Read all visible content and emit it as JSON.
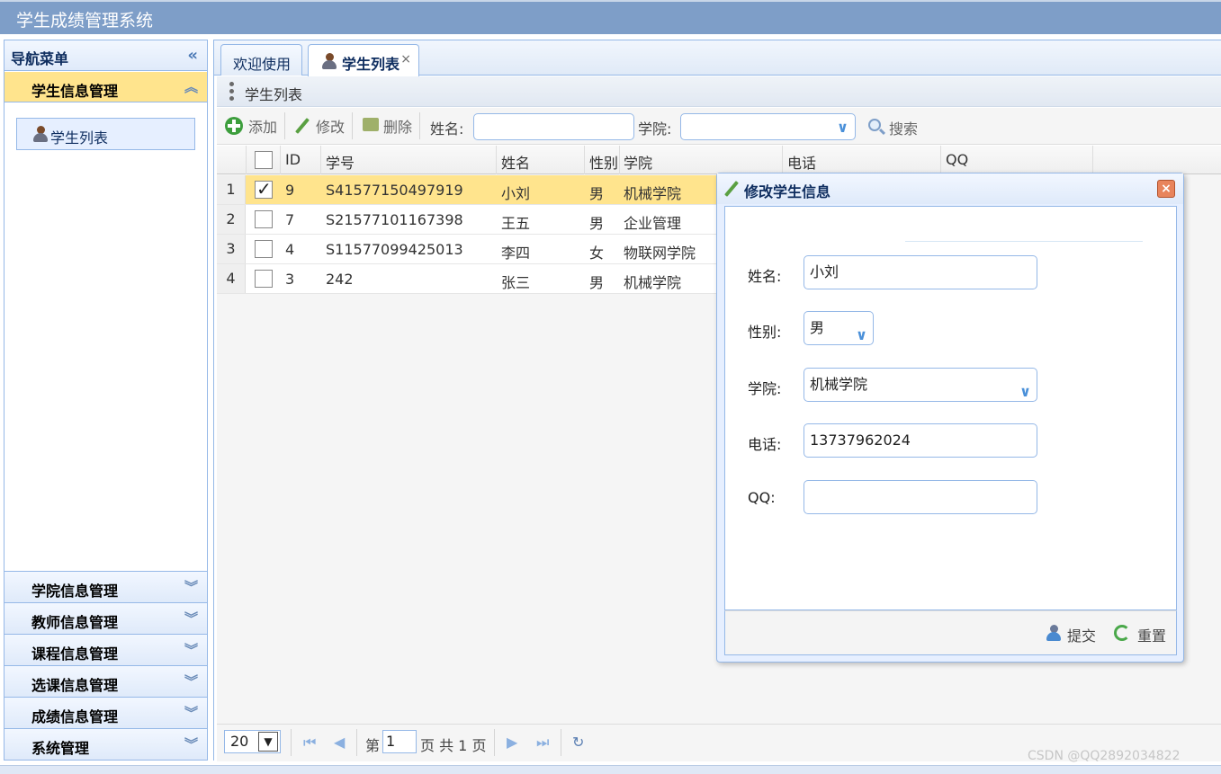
{
  "app": {
    "title": "学生成绩管理系统"
  },
  "sidebar": {
    "title": "导航菜单",
    "open_section": {
      "label": "学生信息管理",
      "items": [
        {
          "label": "学生列表"
        }
      ]
    },
    "sections": [
      {
        "label": "学院信息管理"
      },
      {
        "label": "教师信息管理"
      },
      {
        "label": "课程信息管理"
      },
      {
        "label": "选课信息管理"
      },
      {
        "label": "成绩信息管理"
      },
      {
        "label": "系统管理"
      }
    ]
  },
  "tabs": [
    {
      "label": "欢迎使用"
    },
    {
      "label": "学生列表"
    }
  ],
  "grid": {
    "title": "学生列表",
    "toolbar": {
      "add_label": "添加",
      "edit_label": "修改",
      "delete_label": "删除",
      "name_label": "姓名:",
      "college_label": "学院:",
      "search_label": "搜索"
    },
    "columns": [
      "ID",
      "学号",
      "姓名",
      "性别",
      "学院",
      "电话",
      "QQ"
    ],
    "rows": [
      {
        "num": "1",
        "checked": true,
        "id": "9",
        "sno": "S41577150497919",
        "name": "小刘",
        "gender": "男",
        "college": "机械学院"
      },
      {
        "num": "2",
        "checked": false,
        "id": "7",
        "sno": "S21577101167398",
        "name": "王五",
        "gender": "男",
        "college": "企业管理"
      },
      {
        "num": "3",
        "checked": false,
        "id": "4",
        "sno": "S11577099425013",
        "name": "李四",
        "gender": "女",
        "college": "物联网学院"
      },
      {
        "num": "4",
        "checked": false,
        "id": "3",
        "sno": "242",
        "name": "张三",
        "gender": "男",
        "college": "机械学院"
      }
    ],
    "pager": {
      "page_size": "20",
      "page_prefix": "第",
      "page_value": "1",
      "page_suffix": "页 共 1 页"
    }
  },
  "dialog": {
    "title": "修改学生信息",
    "fields": {
      "name": {
        "label": "姓名:",
        "value": "小刘"
      },
      "gender": {
        "label": "性别:",
        "value": "男"
      },
      "college": {
        "label": "学院:",
        "value": "机械学院"
      },
      "phone": {
        "label": "电话:",
        "value": "13737962024"
      },
      "qq": {
        "label": "QQ:",
        "value": ""
      }
    },
    "submit_label": "提交",
    "reset_label": "重置"
  },
  "watermark": "CSDN @QQ2892034822",
  "colors": {
    "header": "#7e9ec8",
    "selected_row": "#ffe48d",
    "border": "#95b8e7"
  }
}
